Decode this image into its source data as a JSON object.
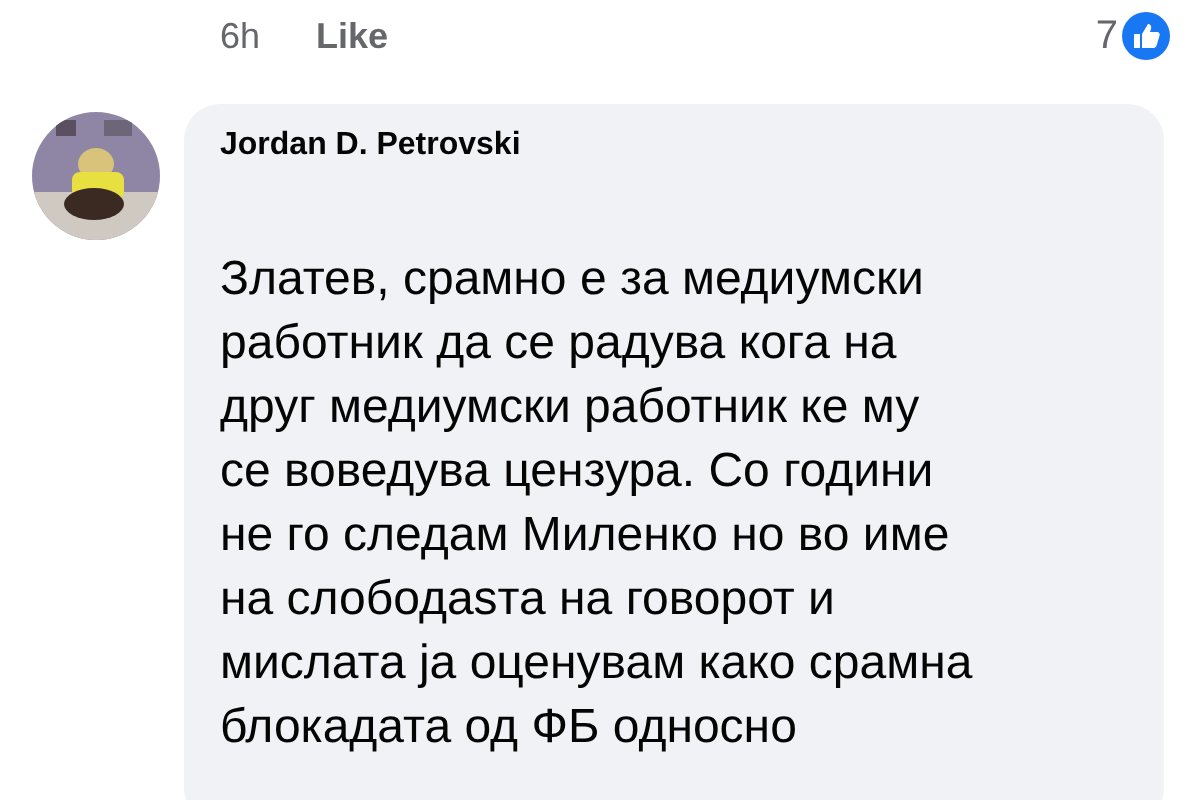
{
  "comment_actions": {
    "time": "6h",
    "like": "Like",
    "reaction_count": "7"
  },
  "comment": {
    "author": "Jordan D. Petrovski",
    "text": "Златев, срамно е за медиумски\nработник да се радува кога на\nдруг медиумски работник ке му\nсе воведува цензура. Со години\nне го следам Миленко но во име\nна слободаѕта на говорот и\nмислата ја оценувам како срамна\nблокадата од ФБ односно"
  }
}
